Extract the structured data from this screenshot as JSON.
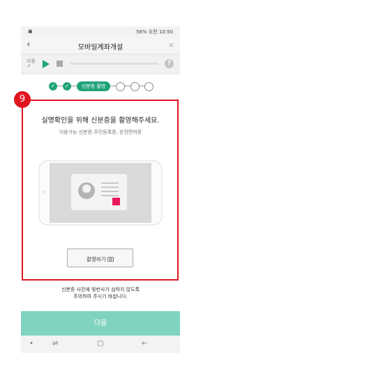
{
  "status_bar": {
    "left_icon": "image-icon",
    "right_text": "56% 오전 10:50"
  },
  "app_bar": {
    "back_icon": "‹",
    "title": "모바일계좌개설",
    "close_icon": "×"
  },
  "player": {
    "auto_label_top": "자동",
    "auto_label_bottom": "↗",
    "help_label": "?"
  },
  "steps": {
    "done_mark": "✓",
    "current_label": "신분증 촬영"
  },
  "content": {
    "title": "실명확인을 위해 신분증을 촬영해주세요.",
    "subtitle": "이용가능 신분증:주민등록증, 운전면허증"
  },
  "capture_button": {
    "label": "촬영하기",
    "icon": "camera-icon"
  },
  "notice": {
    "line1": "신분증 사진에 빛반사가 심하지 않도록",
    "line2": "주의하여 주시기 바랍니다."
  },
  "next_button": {
    "label": "다음"
  },
  "nav_bar": {
    "dot": "•",
    "recent": "⇌",
    "home": "▢",
    "back": "←"
  },
  "annotation": {
    "badge_number": "9"
  },
  "colors": {
    "accent": "#1fa37a",
    "next_disabled": "#80d4bf",
    "highlight": "#e0141e",
    "id_photo_mark": "#e8195a"
  }
}
